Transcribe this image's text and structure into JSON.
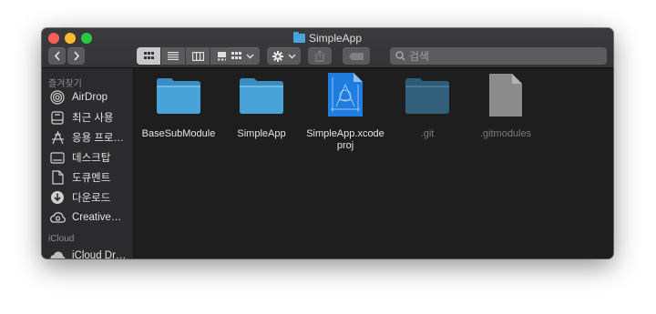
{
  "window": {
    "title": "SimpleApp",
    "search_placeholder": "검색"
  },
  "toolbar": {
    "back_icon": "chevron-left-icon",
    "forward_icon": "chevron-right-icon",
    "view_modes": [
      "icon-view",
      "list-view",
      "column-view",
      "gallery-view"
    ],
    "active_view": "icon-view",
    "group_icon": "grid-icon",
    "action_icon": "gear-icon",
    "share_icon": "share-icon",
    "tag_icon": "tag-icon"
  },
  "sidebar": {
    "favorites_header": "즐겨찾기",
    "favorites": [
      {
        "label": "AirDrop",
        "icon": "airdrop-icon"
      },
      {
        "label": "최근 사용",
        "icon": "recents-icon"
      },
      {
        "label": "응용 프로…",
        "icon": "applications-icon"
      },
      {
        "label": "데스크탑",
        "icon": "desktop-icon"
      },
      {
        "label": "도큐멘트",
        "icon": "documents-icon"
      },
      {
        "label": "다운로드",
        "icon": "downloads-icon"
      },
      {
        "label": "Creative…",
        "icon": "creative-cloud-icon"
      }
    ],
    "icloud_header": "iCloud",
    "icloud": [
      {
        "label": "iCloud Dr…",
        "icon": "cloud-icon"
      }
    ]
  },
  "files": [
    {
      "name": "BaseSubModule",
      "kind": "folder",
      "hidden": false
    },
    {
      "name": "SimpleApp",
      "kind": "folder",
      "hidden": false
    },
    {
      "name": "SimpleApp.xcode",
      "name2": "proj",
      "kind": "xcodeproj",
      "hidden": false
    },
    {
      "name": ".git",
      "kind": "folder",
      "hidden": true
    },
    {
      "name": ".gitmodules",
      "kind": "document",
      "hidden": true
    }
  ],
  "colors": {
    "folder": "#4aa3d8",
    "accent_close": "#fc5f57",
    "accent_minimize": "#fdbc2e",
    "accent_zoom": "#29c840"
  }
}
